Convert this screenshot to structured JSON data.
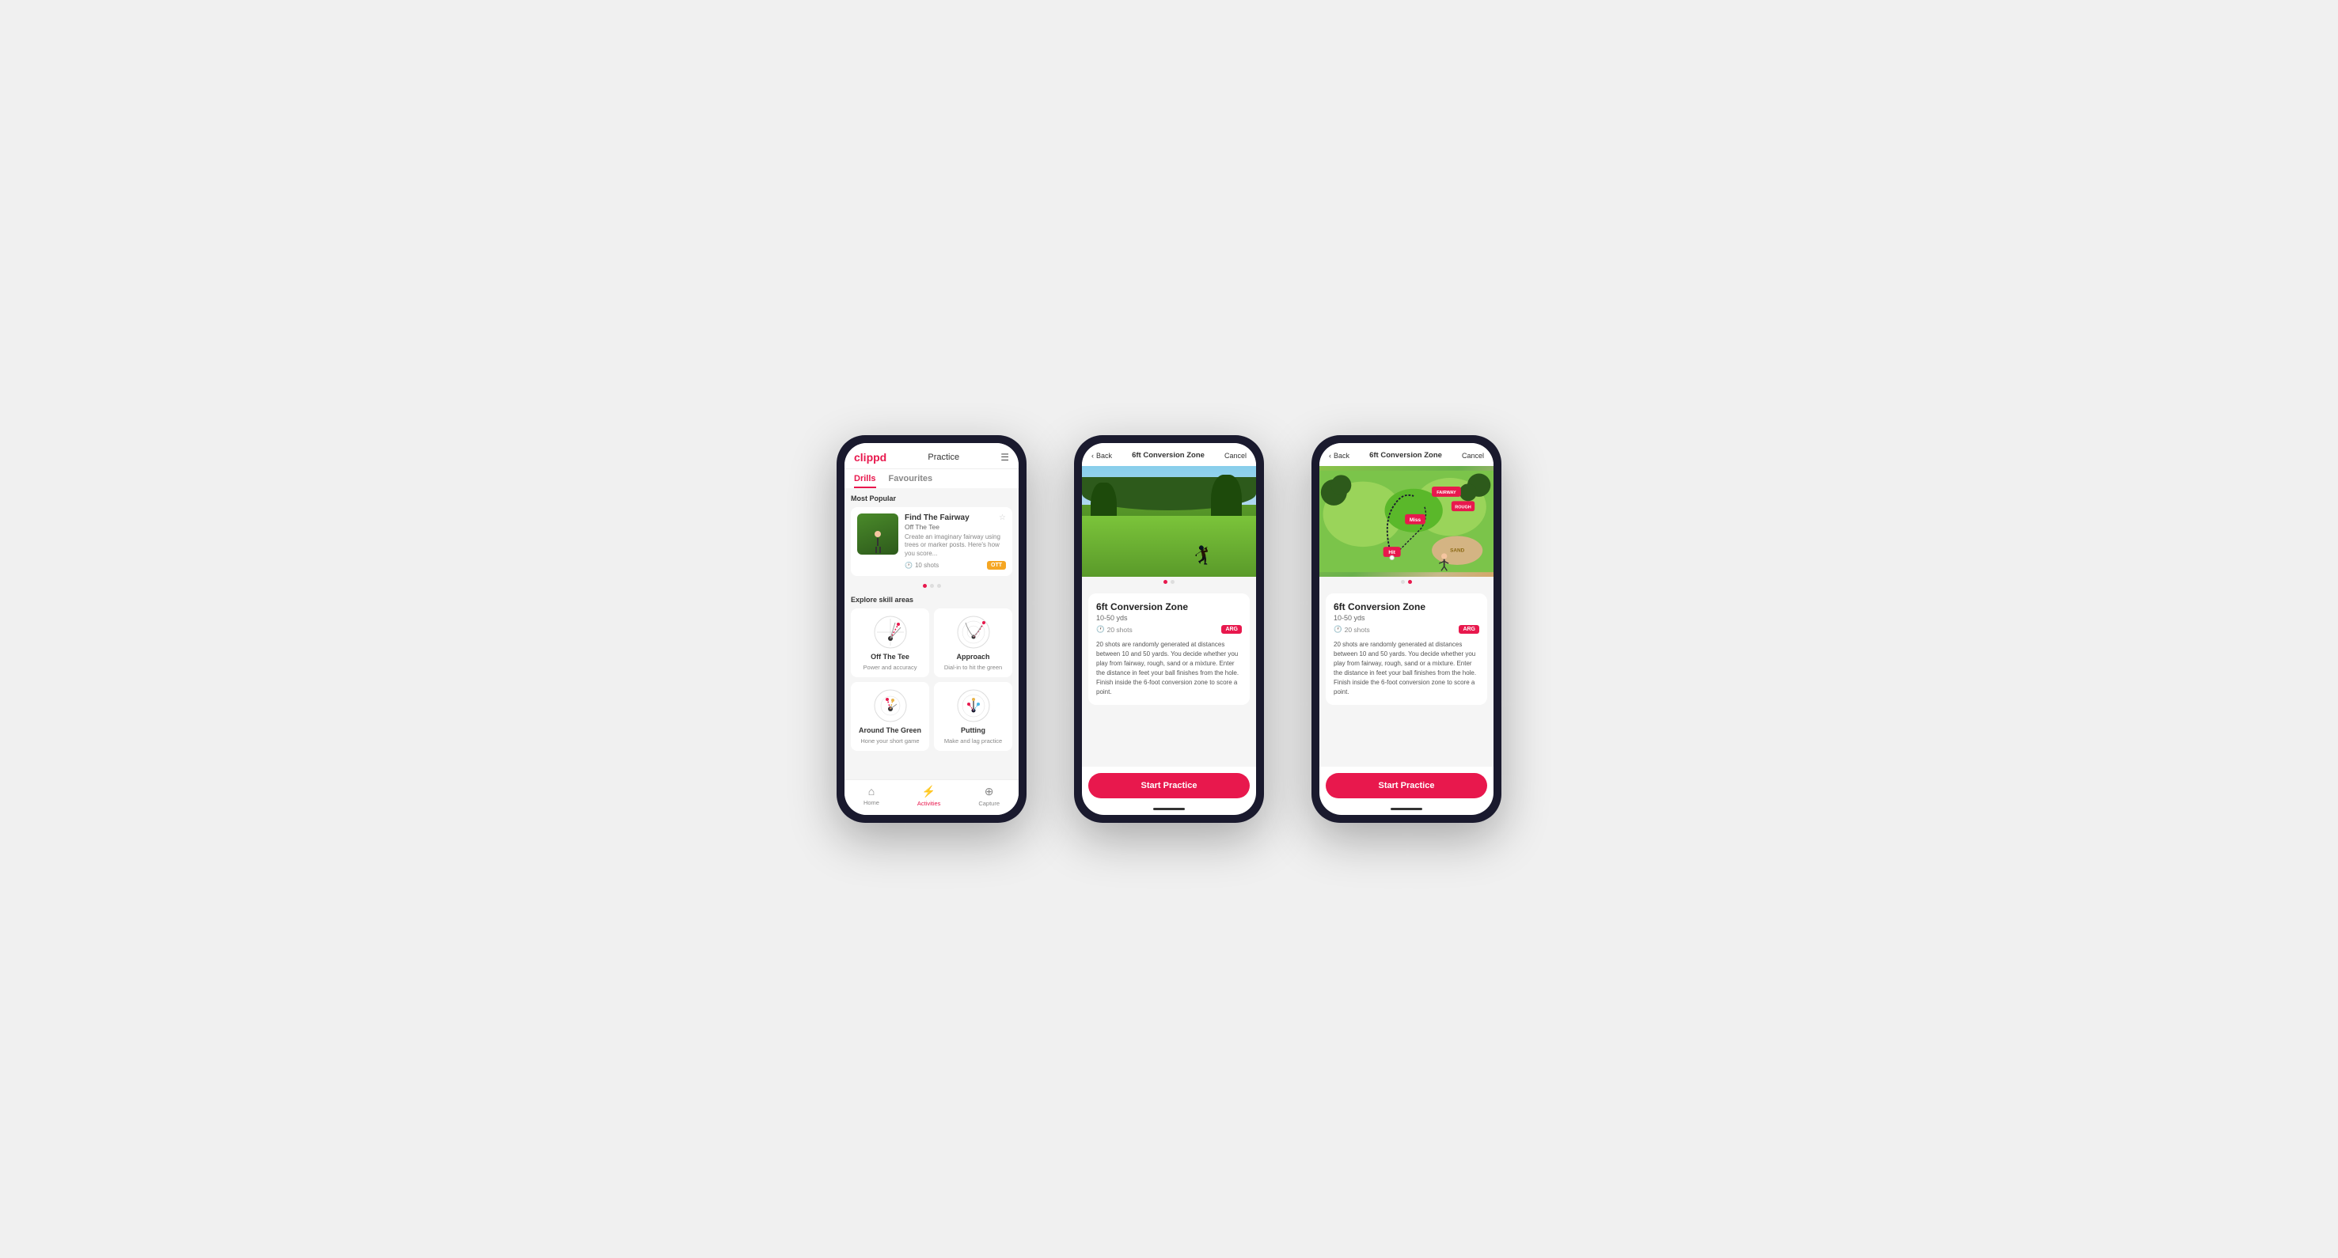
{
  "phones": [
    {
      "id": "phone1",
      "header": {
        "logo": "clippd",
        "title": "Practice",
        "menu_icon": "☰"
      },
      "tabs": [
        {
          "label": "Drills",
          "active": true
        },
        {
          "label": "Favourites",
          "active": false
        }
      ],
      "most_popular_label": "Most Popular",
      "featured_drill": {
        "title": "Find The Fairway",
        "subtitle": "Off The Tee",
        "description": "Create an imaginary fairway using trees or marker posts. Here's how you score...",
        "shots": "10 shots",
        "tag": "OTT"
      },
      "explore_label": "Explore skill areas",
      "skill_areas": [
        {
          "name": "Off The Tee",
          "desc": "Power and accuracy",
          "icon": "ott"
        },
        {
          "name": "Approach",
          "desc": "Dial-in to hit the green",
          "icon": "approach"
        },
        {
          "name": "Around The Green",
          "desc": "Hone your short game",
          "icon": "atg"
        },
        {
          "name": "Putting",
          "desc": "Make and lag practice",
          "icon": "putting"
        }
      ],
      "bottom_nav": [
        {
          "label": "Home",
          "icon": "⌂",
          "active": false
        },
        {
          "label": "Activities",
          "icon": "⚡",
          "active": true
        },
        {
          "label": "Capture",
          "icon": "⊕",
          "active": false
        }
      ]
    },
    {
      "id": "phone2",
      "header": {
        "back_label": "Back",
        "title": "6ft Conversion Zone",
        "cancel_label": "Cancel"
      },
      "drill": {
        "title": "6ft Conversion Zone",
        "yards": "10-50 yds",
        "shots": "20 shots",
        "tag": "ARG",
        "description": "20 shots are randomly generated at distances between 10 and 50 yards. You decide whether you play from fairway, rough, sand or a mixture. Enter the distance in feet your ball finishes from the hole. Finish inside the 6-foot conversion zone to score a point.",
        "start_label": "Start Practice"
      },
      "image_type": "photo"
    },
    {
      "id": "phone3",
      "header": {
        "back_label": "Back",
        "title": "6ft Conversion Zone",
        "cancel_label": "Cancel"
      },
      "drill": {
        "title": "6ft Conversion Zone",
        "yards": "10-50 yds",
        "shots": "20 shots",
        "tag": "ARG",
        "description": "20 shots are randomly generated at distances between 10 and 50 yards. You decide whether you play from fairway, rough, sand or a mixture. Enter the distance in feet your ball finishes from the hole. Finish inside the 6-foot conversion zone to score a point.",
        "start_label": "Start Practice"
      },
      "image_type": "map"
    }
  ]
}
